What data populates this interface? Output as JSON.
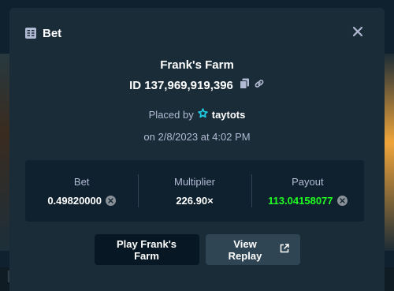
{
  "modal": {
    "title": "Bet",
    "icon": "bet-slip-icon",
    "close_icon": "close-icon"
  },
  "bet": {
    "game": "Frank's Farm",
    "id": "ID 137,969,919,396",
    "placed_by_label": "Placed by",
    "user": "taytots",
    "date": "on 2/8/2023 at 4:02 PM"
  },
  "stats": {
    "bet_label": "Bet",
    "bet_value": "0.49820000",
    "multiplier_label": "Multiplier",
    "multiplier_value": "226.90×",
    "payout_label": "Payout",
    "payout_value": "113.04158077"
  },
  "buttons": {
    "play_label": "Play Frank's Farm",
    "replay_label": "View Replay"
  },
  "colors": {
    "payout_green": "#1fff20",
    "star": "#1fd0e8",
    "modal_bg": "#1a2c38",
    "panel_bg": "#0f212e"
  }
}
